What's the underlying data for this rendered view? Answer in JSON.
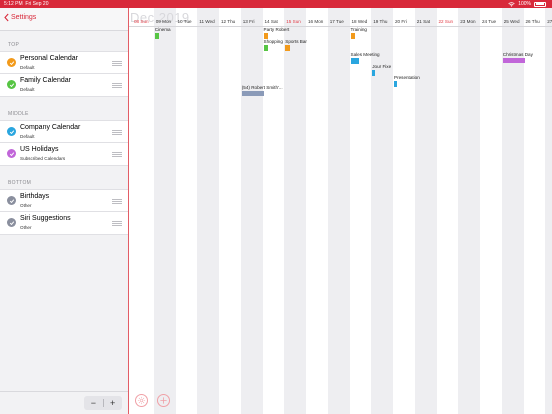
{
  "status": {
    "time": "5:12 PM",
    "date": "Fri Sep 20",
    "battery": "100%"
  },
  "sidebar": {
    "back_label": "Settings",
    "sections": [
      {
        "title": "TOP",
        "items": [
          {
            "name": "Personal Calendar",
            "sub": "Default",
            "color": "#f29a1b"
          },
          {
            "name": "Family Calendar",
            "sub": "Default",
            "color": "#57c544"
          }
        ]
      },
      {
        "title": "MIDDLE",
        "items": [
          {
            "name": "Company Calendar",
            "sub": "Default",
            "color": "#2aa6df"
          },
          {
            "name": "US Holidays",
            "sub": "Subscribed Calendars",
            "color": "#c166d9"
          }
        ]
      },
      {
        "title": "BOTTOM",
        "items": [
          {
            "name": "Birthdays",
            "sub": "Other",
            "color": "#8a8f9e"
          },
          {
            "name": "Siri Suggestions",
            "sub": "Other",
            "color": "#8a8f9e"
          }
        ]
      }
    ],
    "stepper": {
      "minus": "−",
      "plus": "+"
    }
  },
  "calendar": {
    "month_watermark": "Dec 2019",
    "days": [
      {
        "label": "08 Sun",
        "sun": true
      },
      {
        "label": "09 Mon"
      },
      {
        "label": "10 Tue"
      },
      {
        "label": "11 Wed"
      },
      {
        "label": "12 Thu"
      },
      {
        "label": "13 Fri"
      },
      {
        "label": "14 Sat"
      },
      {
        "label": "15 Sun",
        "sun": true
      },
      {
        "label": "16 Mon"
      },
      {
        "label": "17 Tue"
      },
      {
        "label": "18 Wed"
      },
      {
        "label": "19 Thu"
      },
      {
        "label": "20 Fri"
      },
      {
        "label": "21 Sat"
      },
      {
        "label": "22 Sun",
        "sun": true
      },
      {
        "label": "23 Mon"
      },
      {
        "label": "24 Tue"
      },
      {
        "label": "25 Wed"
      },
      {
        "label": "26 Thu"
      },
      {
        "label": "27 Fri"
      }
    ],
    "events": [
      {
        "title": "Cinema",
        "day": 1,
        "row": 0,
        "color": "#57c544",
        "span": 0.2
      },
      {
        "title": "Party Robert",
        "day": 6,
        "row": 0,
        "color": "#f29a1b",
        "span": 0.2
      },
      {
        "title": "Training",
        "day": 10,
        "row": 0,
        "color": "#f29a1b",
        "span": 0.2
      },
      {
        "title": "Shopping",
        "day": 6,
        "row": 1,
        "color": "#57c544",
        "span": 0.2
      },
      {
        "title": "Sports Bar",
        "day": 7,
        "row": 1,
        "color": "#f29a1b",
        "span": 0.2
      },
      {
        "title": "Sales Meeting",
        "day": 10,
        "row": 2,
        "color": "#2aa6df",
        "span": 0.4
      },
      {
        "title": "Christmas Day",
        "day": 17,
        "row": 2,
        "color": "#c166d9",
        "span": 1
      },
      {
        "title": "Jour Fixe",
        "day": 11,
        "row": 3,
        "color": "#2aa6df",
        "span": 0.12
      },
      {
        "title": "Presentation",
        "day": 12,
        "row": 4,
        "color": "#2aa6df",
        "span": 0.12
      },
      {
        "title": "(54) Robert Smith'...",
        "day": 5,
        "row": 5,
        "color": "#8a9ab8",
        "span": 1
      }
    ]
  }
}
